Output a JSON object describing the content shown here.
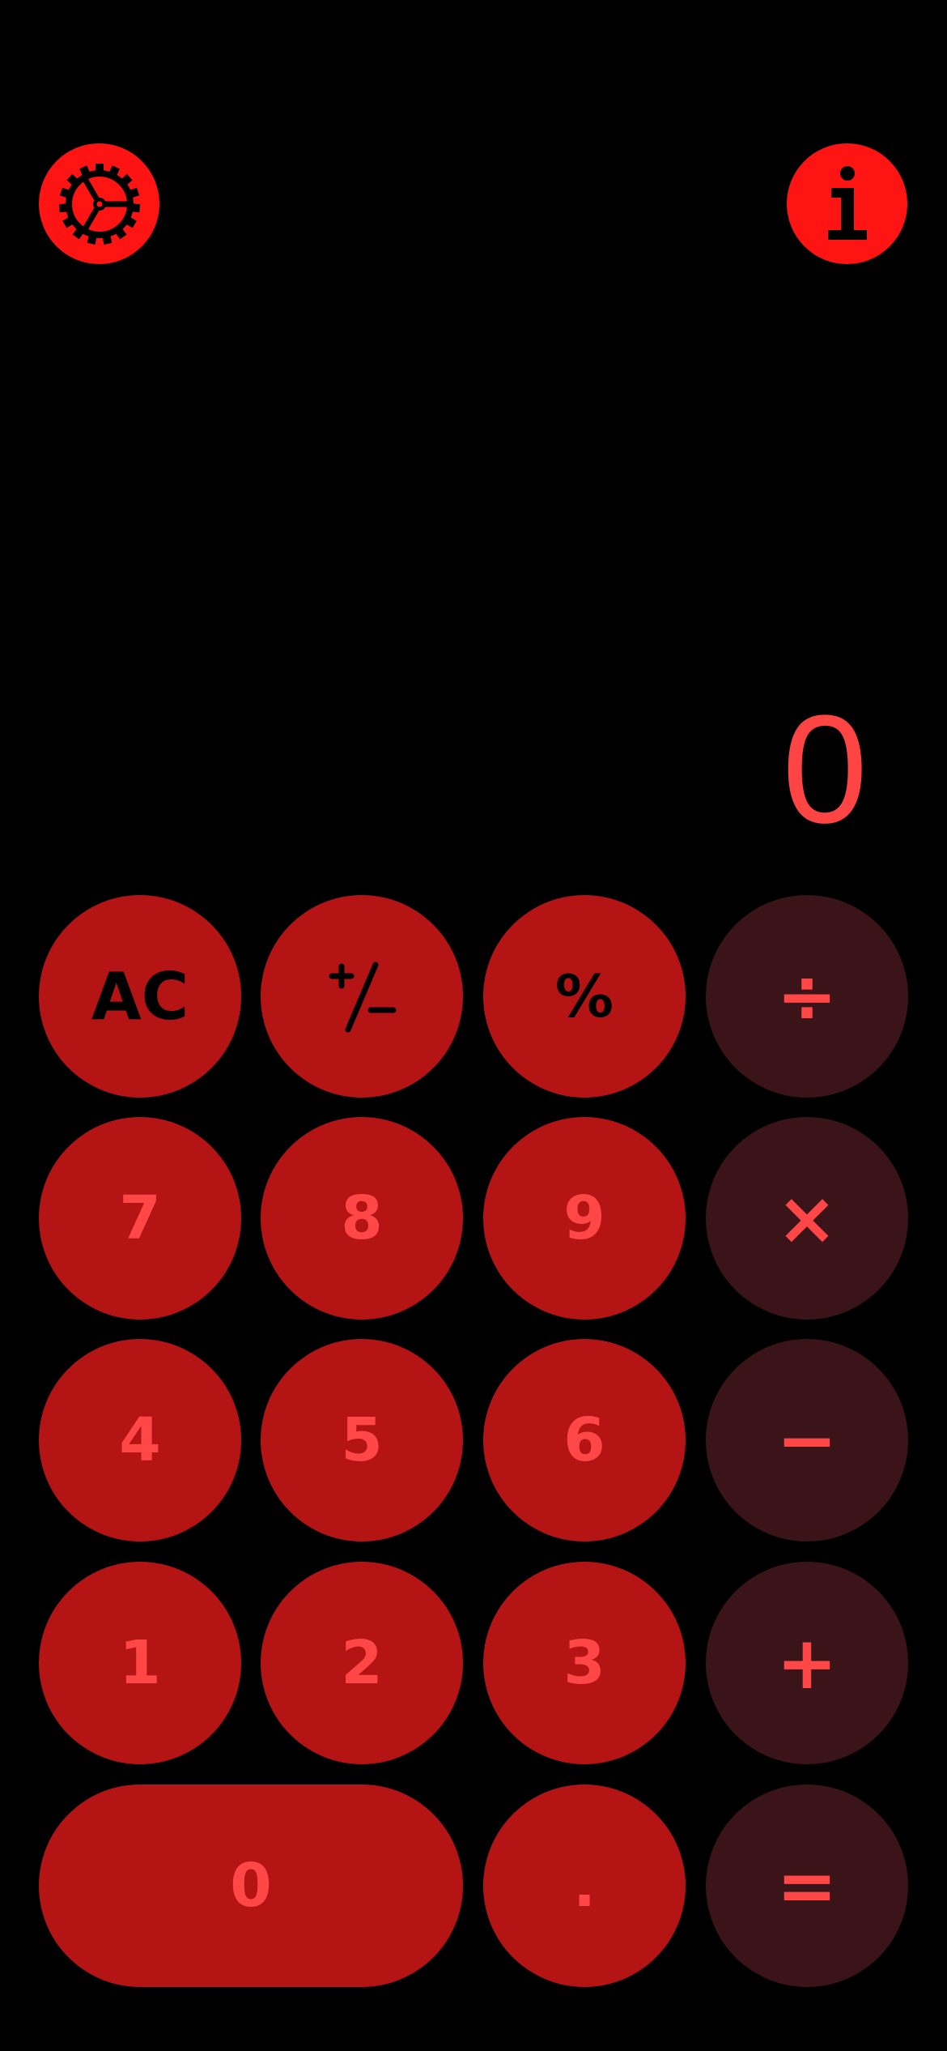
{
  "header": {
    "settings_icon": "gear-icon",
    "info_icon": "info-icon"
  },
  "display": {
    "value": "0"
  },
  "keypad": {
    "clear": "AC",
    "sign": "+/−",
    "percent": "%",
    "divide": "÷",
    "multiply": "×",
    "subtract": "−",
    "add": "+",
    "equals": "=",
    "decimal": ".",
    "digits": {
      "0": "0",
      "1": "1",
      "2": "2",
      "3": "3",
      "4": "4",
      "5": "5",
      "6": "6",
      "7": "7",
      "8": "8",
      "9": "9"
    }
  },
  "colors": {
    "background": "#000000",
    "top_button": "#ff1414",
    "digit_key": "#b51414",
    "operator_key": "#3a1419",
    "accent_text": "#ff4747",
    "dark_text": "#000000"
  }
}
